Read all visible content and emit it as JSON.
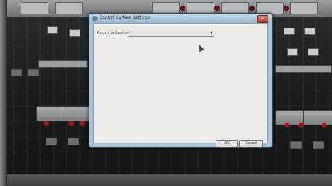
{
  "dialog": {
    "title": "Control Surface Settings",
    "close_symbol": "×",
    "mode_label": "Control surface mode",
    "mode_value": "",
    "ok_label": "OK",
    "cancel_label": "Cancel"
  },
  "colors": {
    "dialog_frame": "#a9c3d6",
    "client_bg": "#ecebe7",
    "close_red": "#b8402c",
    "led_red": "#b01414"
  },
  "icons": [
    "window-icon",
    "close-icon",
    "chevron-down-icon",
    "mouse-cursor-icon"
  ]
}
